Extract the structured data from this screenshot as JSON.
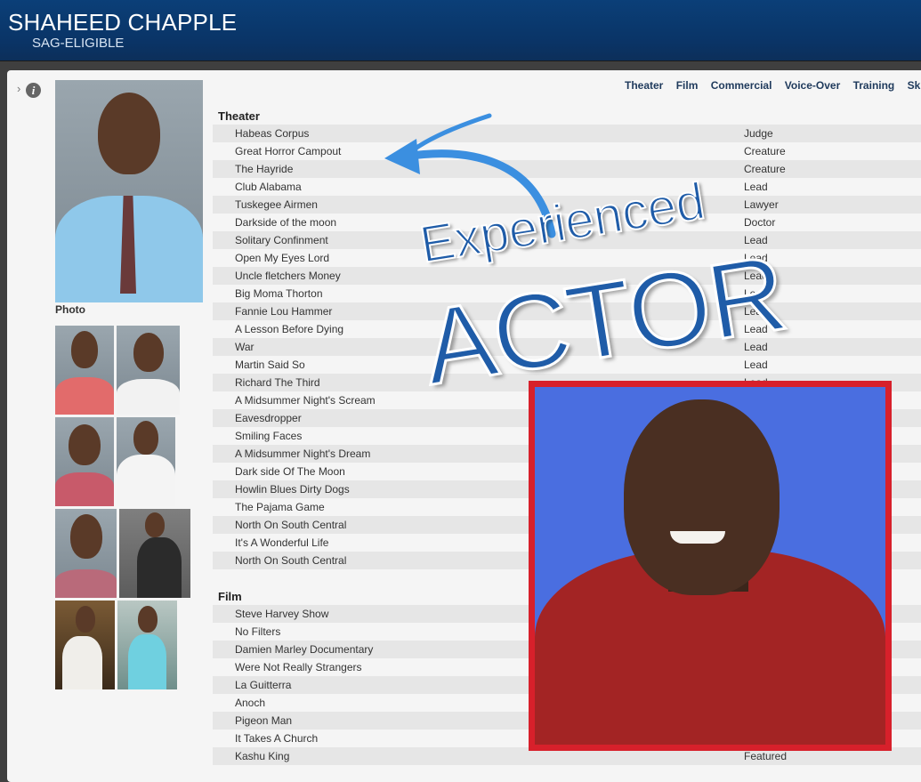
{
  "header": {
    "name": "SHAHEED CHAPPLE",
    "union": "SAG-ELIGIBLE"
  },
  "sidebar": {
    "expand_icon": "chevron-right-icon",
    "info_icon": "info-icon",
    "photo_caption": "Photo"
  },
  "tabs": [
    "Theater",
    "Film",
    "Commercial",
    "Voice-Over",
    "Training",
    "Skil"
  ],
  "theater": {
    "heading": "Theater",
    "credits": [
      {
        "title": "Habeas Corpus",
        "role": "Judge"
      },
      {
        "title": "Great Horror Campout",
        "role": "Creature"
      },
      {
        "title": "The Hayride",
        "role": "Creature"
      },
      {
        "title": "Club Alabama",
        "role": "Lead"
      },
      {
        "title": "Tuskegee Airmen",
        "role": "Lawyer"
      },
      {
        "title": "Darkside of the moon",
        "role": "Doctor"
      },
      {
        "title": "Solitary Confinment",
        "role": "Lead"
      },
      {
        "title": "Open My Eyes Lord",
        "role": "Lead"
      },
      {
        "title": "Uncle fletchers Money",
        "role": "Lead"
      },
      {
        "title": "Big Moma Thorton",
        "role": "Lead"
      },
      {
        "title": "Fannie Lou Hammer",
        "role": "Lead"
      },
      {
        "title": "A Lesson Before Dying",
        "role": "Lead"
      },
      {
        "title": "War",
        "role": "Lead"
      },
      {
        "title": "Martin Said So",
        "role": "Lead"
      },
      {
        "title": "Richard The Third",
        "role": "Lead"
      },
      {
        "title": "A Midsummer Night's Scream",
        "role": ""
      },
      {
        "title": "Eavesdropper",
        "role": ""
      },
      {
        "title": "Smiling Faces",
        "role": ""
      },
      {
        "title": "A Midsummer Night's Dream",
        "role": ""
      },
      {
        "title": "Dark side Of The Moon",
        "role": ""
      },
      {
        "title": "Howlin Blues Dirty Dogs",
        "role": ""
      },
      {
        "title": "The Pajama Game",
        "role": ""
      },
      {
        "title": "North On South Central",
        "role": ""
      },
      {
        "title": "It's A Wonderful Life",
        "role": ""
      },
      {
        "title": "North On South Central",
        "role": ""
      }
    ]
  },
  "film": {
    "heading": "Film",
    "credits": [
      {
        "title": "Steve Harvey Show",
        "role": ""
      },
      {
        "title": "No Filters",
        "role": ""
      },
      {
        "title": "Damien Marley Documentary",
        "role": ""
      },
      {
        "title": "Were Not Really Strangers",
        "role": ""
      },
      {
        "title": "La Guitterra",
        "role": ""
      },
      {
        "title": "Anoch",
        "role": ""
      },
      {
        "title": "Pigeon Man",
        "role": ""
      },
      {
        "title": "It Takes A Church",
        "role": ""
      },
      {
        "title": "Kashu King",
        "role": "Featured"
      }
    ]
  },
  "overlay": {
    "line1": "Experienced",
    "line2": "ACTOR",
    "arrow_icon": "curved-arrow-icon"
  },
  "colors": {
    "header": "#0a3466",
    "overlay_text": "#1f5ca8",
    "frame": "#d7202b",
    "photo_backdrop": "#4a6ee0"
  }
}
